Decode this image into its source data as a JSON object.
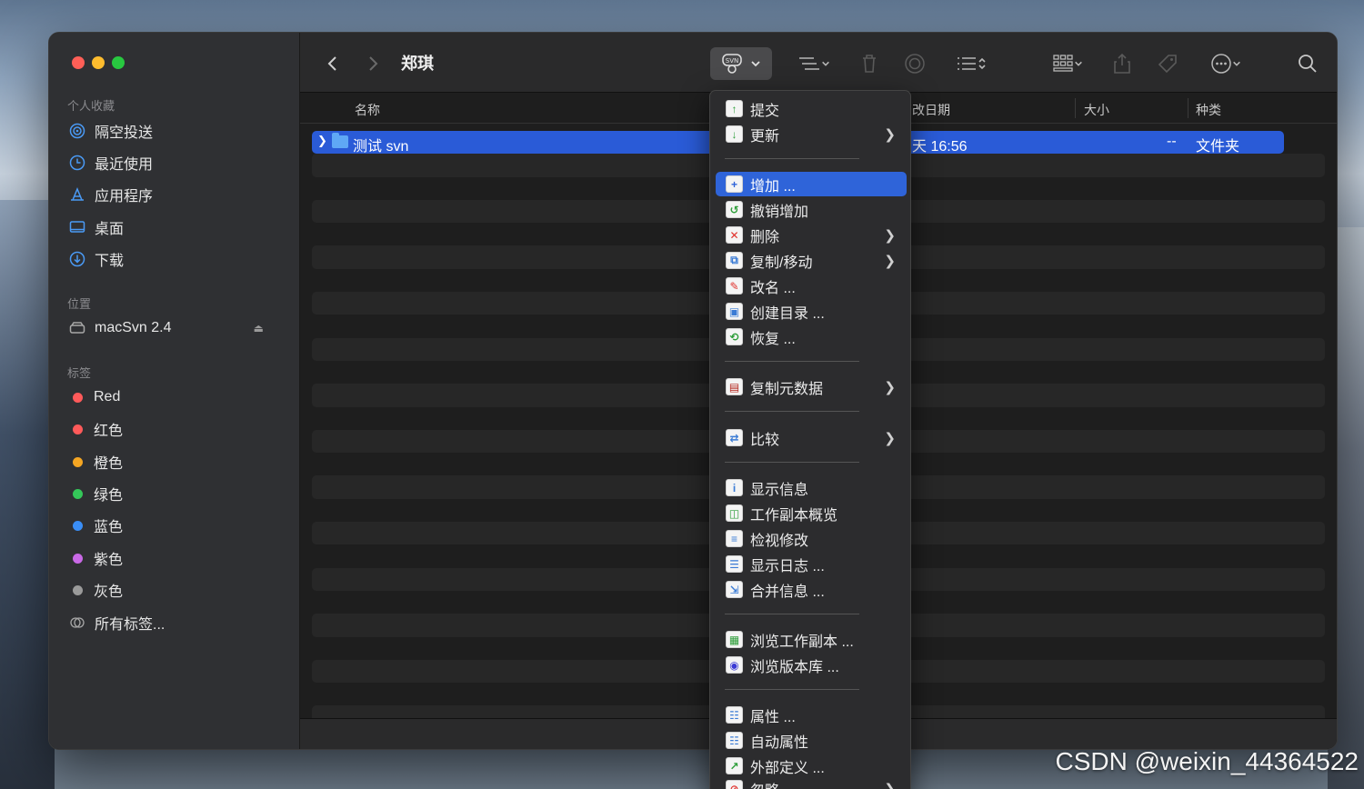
{
  "window": {
    "title": "郑琪"
  },
  "sidebar": {
    "favorites_header": "个人收藏",
    "favorites": [
      {
        "label": "隔空投送",
        "icon": "airdrop-icon"
      },
      {
        "label": "最近使用",
        "icon": "clock-icon"
      },
      {
        "label": "应用程序",
        "icon": "apps-icon"
      },
      {
        "label": "桌面",
        "icon": "desktop-icon"
      },
      {
        "label": "下载",
        "icon": "download-icon"
      }
    ],
    "locations_header": "位置",
    "locations": [
      {
        "label": "macSvn 2.4",
        "icon": "drive-icon"
      }
    ],
    "tags_header": "标签",
    "tags": [
      {
        "label": "Red",
        "color": "#ff5a5a"
      },
      {
        "label": "红色",
        "color": "#ff5a5a"
      },
      {
        "label": "橙色",
        "color": "#f5a623"
      },
      {
        "label": "绿色",
        "color": "#34c759"
      },
      {
        "label": "蓝色",
        "color": "#3a8ef6"
      },
      {
        "label": "紫色",
        "color": "#c969e6"
      },
      {
        "label": "灰色",
        "color": "#9a9a9a"
      }
    ],
    "all_tags": "所有标签..."
  },
  "header": {
    "name": "名称",
    "date": "改日期",
    "size": "大小",
    "kind": "种类"
  },
  "file": {
    "name": "测试 svn",
    "date": "天 16:56",
    "size": "--",
    "kind": "文件夹"
  },
  "menu": {
    "items": [
      {
        "label": "提交",
        "icon": "commit-icon"
      },
      {
        "label": "更新",
        "icon": "update-icon",
        "submenu": true
      },
      {
        "label": "增加 ...",
        "icon": "add-icon",
        "highlight": true
      },
      {
        "label": "撤销增加",
        "icon": "revert-add-icon"
      },
      {
        "label": "删除",
        "icon": "delete-icon",
        "submenu": true
      },
      {
        "label": "复制/移动",
        "icon": "copy-move-icon",
        "submenu": true
      },
      {
        "label": "改名 ...",
        "icon": "rename-icon"
      },
      {
        "label": "创建目录 ...",
        "icon": "mkdir-icon"
      },
      {
        "label": "恢复 ...",
        "icon": "restore-icon"
      },
      {
        "label": "复制元数据",
        "icon": "metadata-icon",
        "submenu": true
      },
      {
        "label": "比较",
        "icon": "compare-icon",
        "submenu": true
      },
      {
        "label": "显示信息",
        "icon": "info-icon"
      },
      {
        "label": "工作副本概览",
        "icon": "overview-icon"
      },
      {
        "label": "检视修改",
        "icon": "review-icon"
      },
      {
        "label": "显示日志 ...",
        "icon": "log-icon"
      },
      {
        "label": "合并信息 ...",
        "icon": "merge-icon"
      },
      {
        "label": "浏览工作副本 ...",
        "icon": "browse-wc-icon"
      },
      {
        "label": "浏览版本库 ...",
        "icon": "browse-repo-icon"
      },
      {
        "label": "属性 ...",
        "icon": "props-icon"
      },
      {
        "label": "自动属性",
        "icon": "auto-props-icon"
      },
      {
        "label": "外部定义 ...",
        "icon": "externals-icon"
      },
      {
        "label": "忽略",
        "icon": "ignore-icon",
        "submenu": true
      }
    ]
  },
  "watermark": "CSDN @weixin_44364522"
}
